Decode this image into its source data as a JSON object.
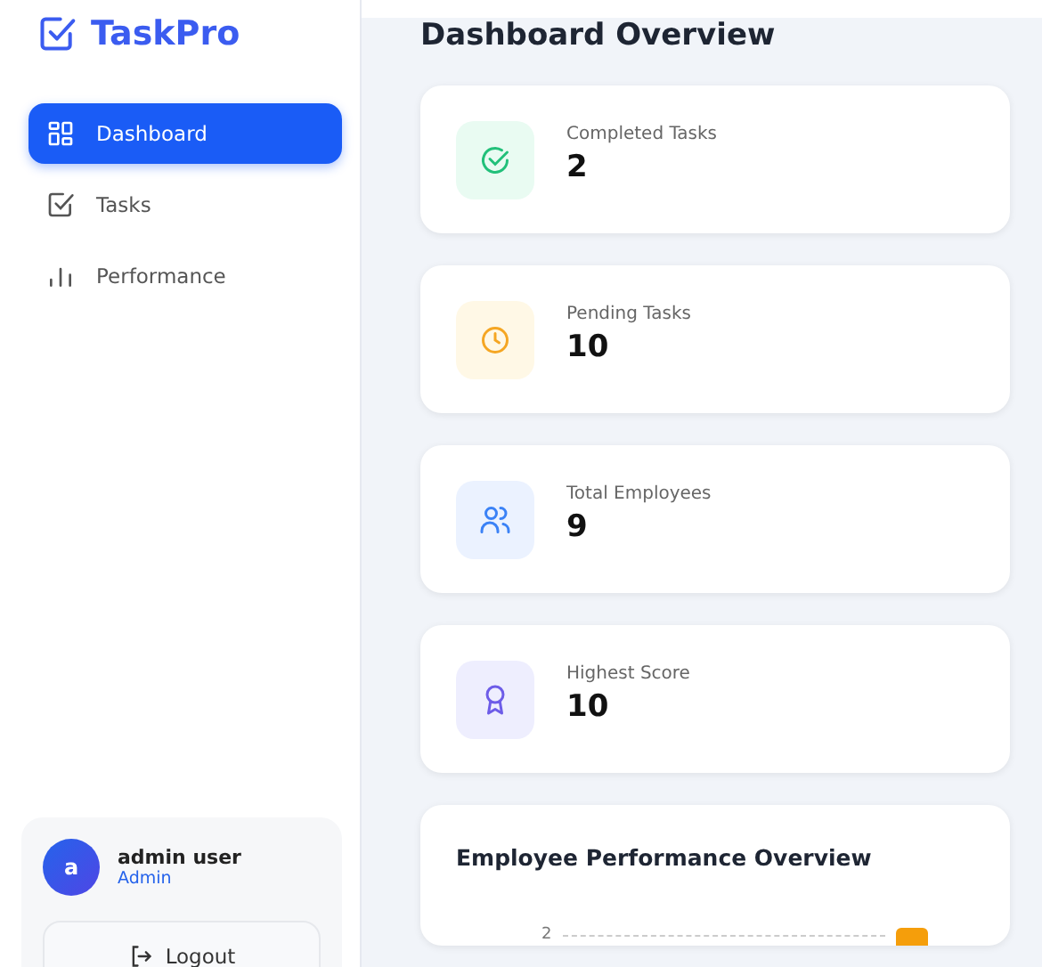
{
  "sidebar": {
    "logo": "TaskPro",
    "items": [
      {
        "kind": "grid",
        "label": "Dashboard",
        "selected": true
      },
      {
        "kind": "check",
        "label": "Tasks",
        "selected": false
      },
      {
        "kind": "bars",
        "label": "Performance",
        "selected": false
      }
    ],
    "user": {
      "initial": "a",
      "name": "admin user",
      "role": "Admin"
    },
    "logout": "Logout"
  },
  "main": {
    "title": "Dashboard Overview",
    "stats": [
      {
        "kind": "check",
        "label": "Completed Tasks",
        "value": "2"
      },
      {
        "kind": "clock",
        "label": "Pending Tasks",
        "value": "10"
      },
      {
        "kind": "users",
        "label": "Total Employees",
        "value": "9"
      },
      {
        "kind": "award",
        "label": "Highest Score",
        "value": "10"
      }
    ],
    "chart": {
      "title": "Employee Performance Overview",
      "ytick": "2"
    }
  }
}
